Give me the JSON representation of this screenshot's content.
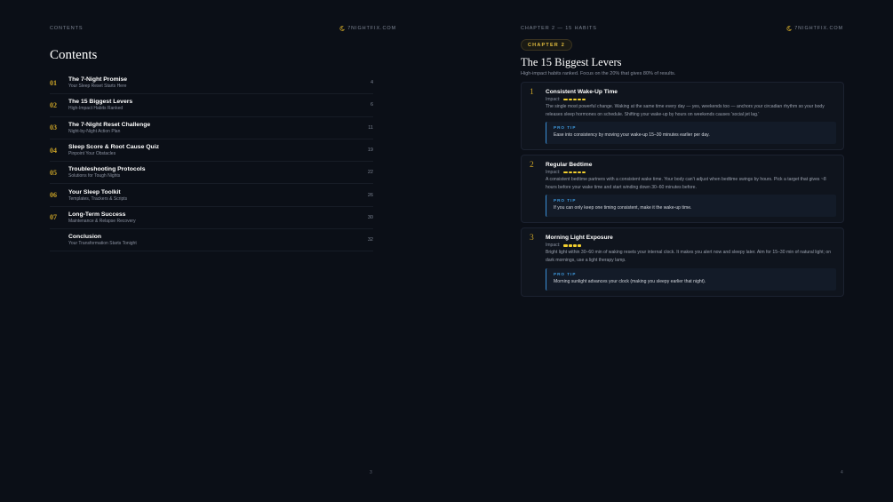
{
  "left": {
    "runhead_left": "CONTENTS",
    "brand": "7NIGHTFIX.COM",
    "title": "Contents",
    "toc": [
      {
        "num": "01",
        "name": "The 7-Night Promise",
        "sub": "Your Sleep Reset Starts Here",
        "page": "4"
      },
      {
        "num": "02",
        "name": "The 15 Biggest Levers",
        "sub": "High-Impact Habits Ranked",
        "page": "6"
      },
      {
        "num": "03",
        "name": "The 7-Night Reset Challenge",
        "sub": "Night-by-Night Action Plan",
        "page": "11"
      },
      {
        "num": "04",
        "name": "Sleep Score & Root Cause Quiz",
        "sub": "Pinpoint Your Obstacles",
        "page": "19"
      },
      {
        "num": "05",
        "name": "Troubleshooting Protocols",
        "sub": "Solutions for Tough Nights",
        "page": "22"
      },
      {
        "num": "06",
        "name": "Your Sleep Toolkit",
        "sub": "Templates, Trackers & Scripts",
        "page": "26"
      },
      {
        "num": "07",
        "name": "Long-Term Success",
        "sub": "Maintenance & Relapse Recovery",
        "page": "30"
      },
      {
        "num": "",
        "name": "Conclusion",
        "sub": "Your Transformation Starts Tonight",
        "page": "32"
      }
    ],
    "folio": "3"
  },
  "right": {
    "runhead_left": "CHAPTER 2 — 15 HABITS",
    "brand": "7NIGHTFIX.COM",
    "badge": "CHAPTER 2",
    "title": "The 15 Biggest Levers",
    "subtitle": "High-impact habits ranked. Focus on the 20% that gives 80% of results.",
    "impact_label": "Impact:",
    "tip_label": "PRO TIP",
    "habits": [
      {
        "num": "1",
        "title": "Consistent Wake-Up Time",
        "impact": 5,
        "body": "The single most powerful change. Waking at the same time every day — yes, weekends too — anchors your circadian rhythm so your body releases sleep hormones on schedule. Shifting your wake-up by hours on weekends causes 'social jet lag.'",
        "tip": "Ease into consistency by moving your wake-up 15–30 minutes earlier per day."
      },
      {
        "num": "2",
        "title": "Regular Bedtime",
        "impact": 5,
        "body": "A consistent bedtime partners with a consistent wake time. Your body can't adjust when bedtime swings by hours. Pick a target that gives ~8 hours before your wake time and start winding down 30–60 minutes before.",
        "tip": "If you can only keep one timing consistent, make it the wake-up time."
      },
      {
        "num": "3",
        "title": "Morning Light Exposure",
        "impact": 4,
        "body": "Bright light within 30–60 min of waking resets your internal clock. It makes you alert now and sleepy later. Aim for 15–30 min of natural light; on dark mornings, use a light therapy lamp.",
        "tip": "Morning sunlight advances your clock (making you sleepy earlier that night)."
      }
    ],
    "folio": "4"
  },
  "colors": {
    "background": "#0b0f17",
    "gold": "#c9a227",
    "impact_yellow": "#f2cf2e",
    "tip_blue": "#3f9be0"
  }
}
